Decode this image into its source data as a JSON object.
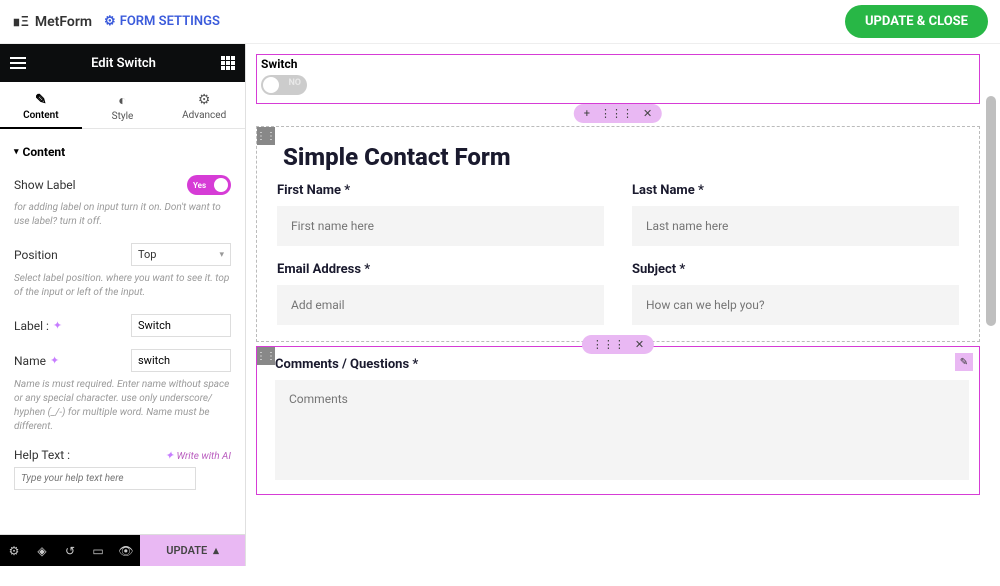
{
  "topbar": {
    "app_name": "MetForm",
    "form_settings_label": "FORM SETTINGS",
    "update_close_label": "UPDATE & CLOSE"
  },
  "panel": {
    "title": "Edit Switch",
    "tabs": {
      "content": "Content",
      "style": "Style",
      "advanced": "Advanced"
    },
    "section_title": "Content",
    "show_label": {
      "label": "Show Label",
      "value": "Yes",
      "help": "for adding label on input turn it on. Don't want to use label? turn it off."
    },
    "position": {
      "label": "Position",
      "value": "Top",
      "help": "Select label position. where you want to see it. top of the input or left of the input."
    },
    "label_field": {
      "label": "Label :",
      "value": "Switch"
    },
    "name_field": {
      "label": "Name",
      "value": "switch",
      "help": "Name is must required. Enter name without space or any special character. use only underscore/ hyphen (_/-) for multiple word. Name must be different."
    },
    "help_text": {
      "label": "Help Text :",
      "ai_link": "Write with AI",
      "placeholder": "Type your help text here"
    },
    "footer": {
      "update_label": "UPDATE"
    }
  },
  "canvas": {
    "switch_label": "Switch",
    "switch_no": "NO",
    "form_title": "Simple Contact Form",
    "fields": {
      "first_name": {
        "label": "First Name *",
        "placeholder": "First name here"
      },
      "last_name": {
        "label": "Last Name *",
        "placeholder": "Last name here"
      },
      "email": {
        "label": "Email Address *",
        "placeholder": "Add email"
      },
      "subject": {
        "label": "Subject *",
        "placeholder": "How can we help you?"
      },
      "comments": {
        "label": "Comments / Questions *",
        "placeholder": "Comments"
      }
    }
  }
}
